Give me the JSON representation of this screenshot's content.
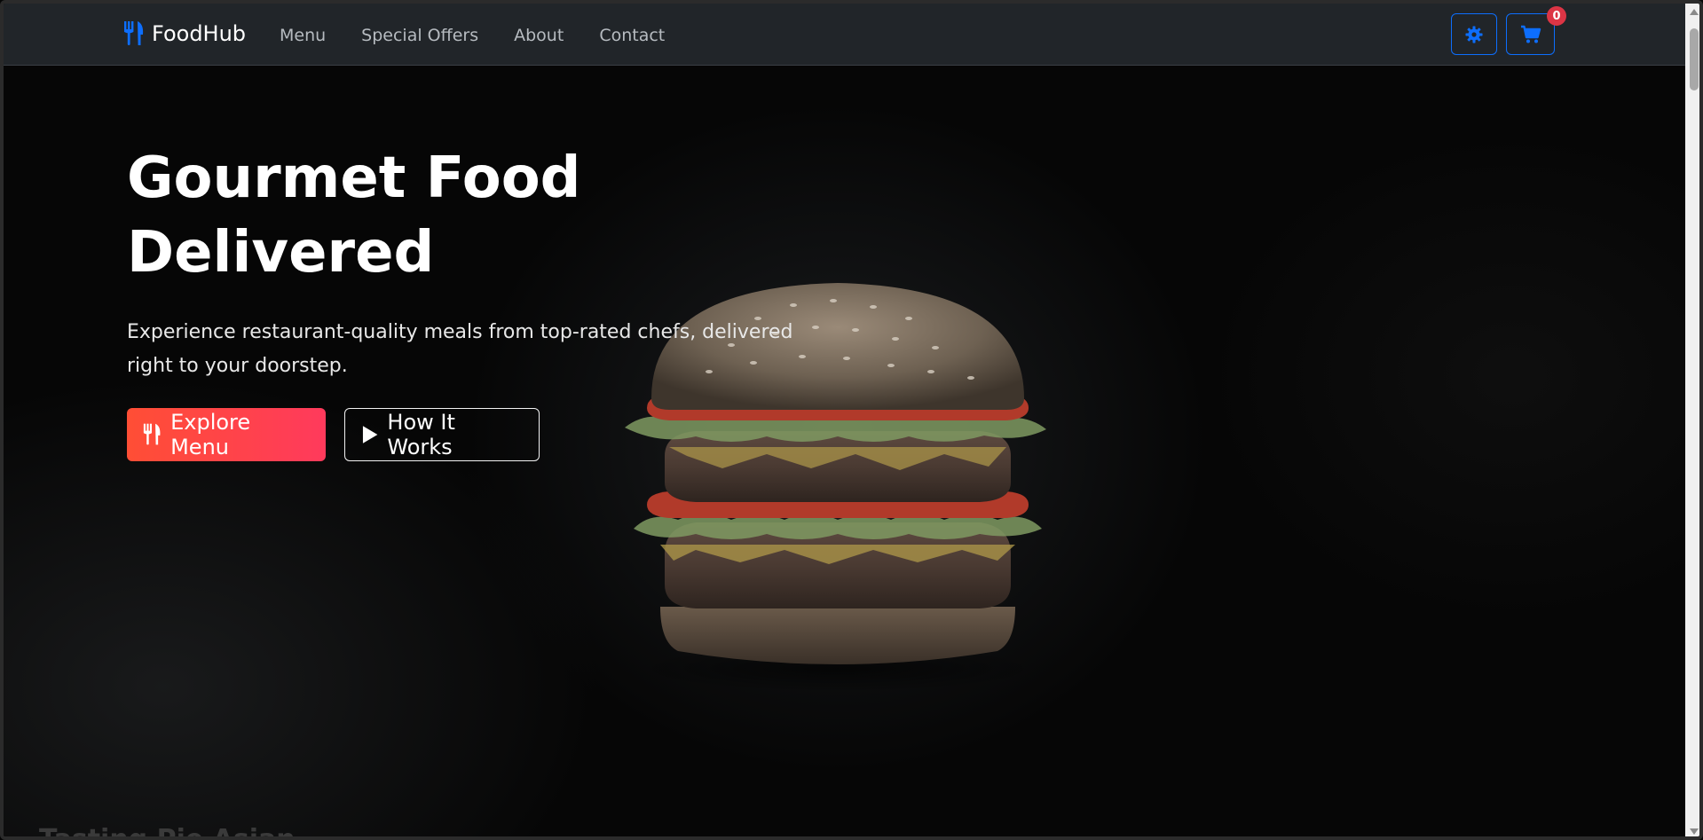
{
  "navbar": {
    "brand": "FoodHub",
    "brand_icon": "utensils-icon",
    "links": [
      "Menu",
      "Special Offers",
      "About",
      "Contact"
    ],
    "theme_icon": "gear-icon",
    "cart_icon": "cart-icon",
    "cart_count": "0"
  },
  "hero": {
    "title": "Gourmet Food Delivered",
    "subtitle": "Experience restaurant-quality meals from top-rated chefs, delivered right to your doorstep.",
    "primary_button": "Explore Menu",
    "secondary_button": "How It Works",
    "peek_text": "Tasting Pie Asian"
  },
  "colors": {
    "navbar_bg": "#212529",
    "accent_blue": "#0d6efd",
    "primary_gradient_start": "#ff4e35",
    "primary_gradient_end": "#ff3a5c",
    "badge_red": "#dc3545"
  }
}
